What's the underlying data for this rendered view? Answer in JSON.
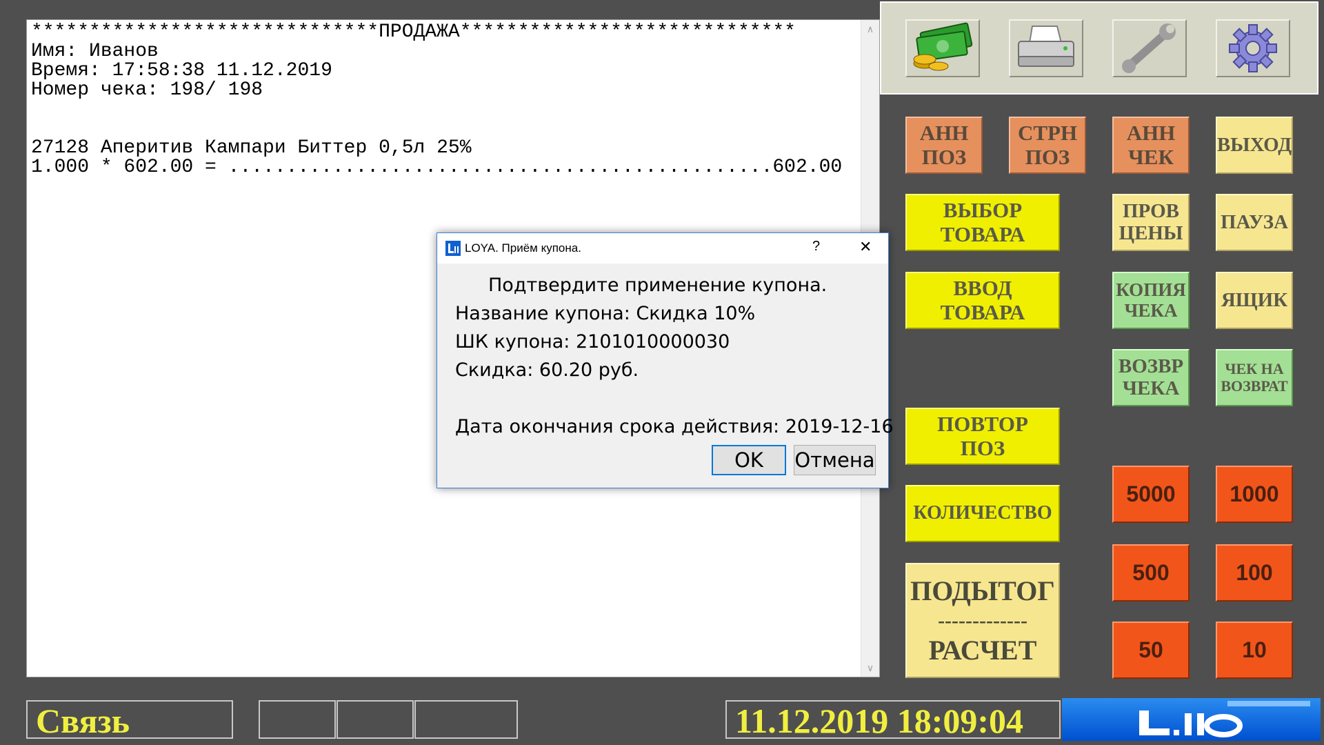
{
  "receipt": {
    "lines": [
      "******************************ПРОДАЖА*****************************",
      "Имя: Иванов",
      "Время: 17:58:38 11.12.2019",
      "Номер чека: 198/ 198",
      "",
      "",
      "27128 Аперитив Кампари Биттер 0,5л 25%",
      "1.000 * 602.00 = ...............................................602.00"
    ]
  },
  "toolbar": {
    "icons": [
      "money-icon",
      "printer-icon",
      "wrench-icon",
      "gear-icon"
    ]
  },
  "buttons": {
    "ann_poz": [
      "АНН",
      "ПОЗ"
    ],
    "strn_poz": [
      "СТРН",
      "ПОЗ"
    ],
    "ann_chek": [
      "АНН",
      "ЧЕК"
    ],
    "exit": "ВЫХОД",
    "vybor_tovara": [
      "ВЫБОР",
      "ТОВАРА"
    ],
    "prov_ceny": [
      "ПРОВ",
      "ЦЕНЫ"
    ],
    "pause": "ПАУЗА",
    "vvod_tovara": [
      "ВВОД",
      "ТОВАРА"
    ],
    "kopiya_cheka": [
      "КОПИЯ",
      "ЧЕКА"
    ],
    "yashchik": "ЯЩИК",
    "vozvr_cheka": [
      "ВОЗВР",
      "ЧЕКА"
    ],
    "chek_na_vozvrat": [
      "ЧЕК НА",
      "ВОЗВРАТ"
    ],
    "povtor_poz": [
      "ПОВТОР",
      "ПОЗ"
    ],
    "kolichestvo": "КОЛИЧЕСТВО",
    "podytog": [
      "ПОДЫТОГ",
      "-------------",
      "РАСЧЕТ"
    ],
    "money": [
      "5000",
      "1000",
      "500",
      "100",
      "50",
      "10"
    ]
  },
  "status": {
    "connection": "Связь",
    "datetime": "11.12.2019 18:09:04"
  },
  "dialog": {
    "title": "LOYA. Приём купона.",
    "help": "?",
    "close": "✕",
    "confirm": "Подтвердите применение купона.",
    "coupon_name": "Название купона: Скидка 10%",
    "coupon_barcode": "ШК купона: 2101010000030",
    "discount": "Скидка: 60.20 руб.",
    "expiry": "Дата окончания срока действия: 2019-12-16",
    "ok": "OK",
    "cancel": "Отмена"
  },
  "colors": {
    "background": "#4f4f4f",
    "orange": "#e6905e",
    "pale_yellow": "#f7e690",
    "yellow": "#f0ef00",
    "green": "#a3df94",
    "money": "#f2551a",
    "status_text": "#f0ef40"
  }
}
